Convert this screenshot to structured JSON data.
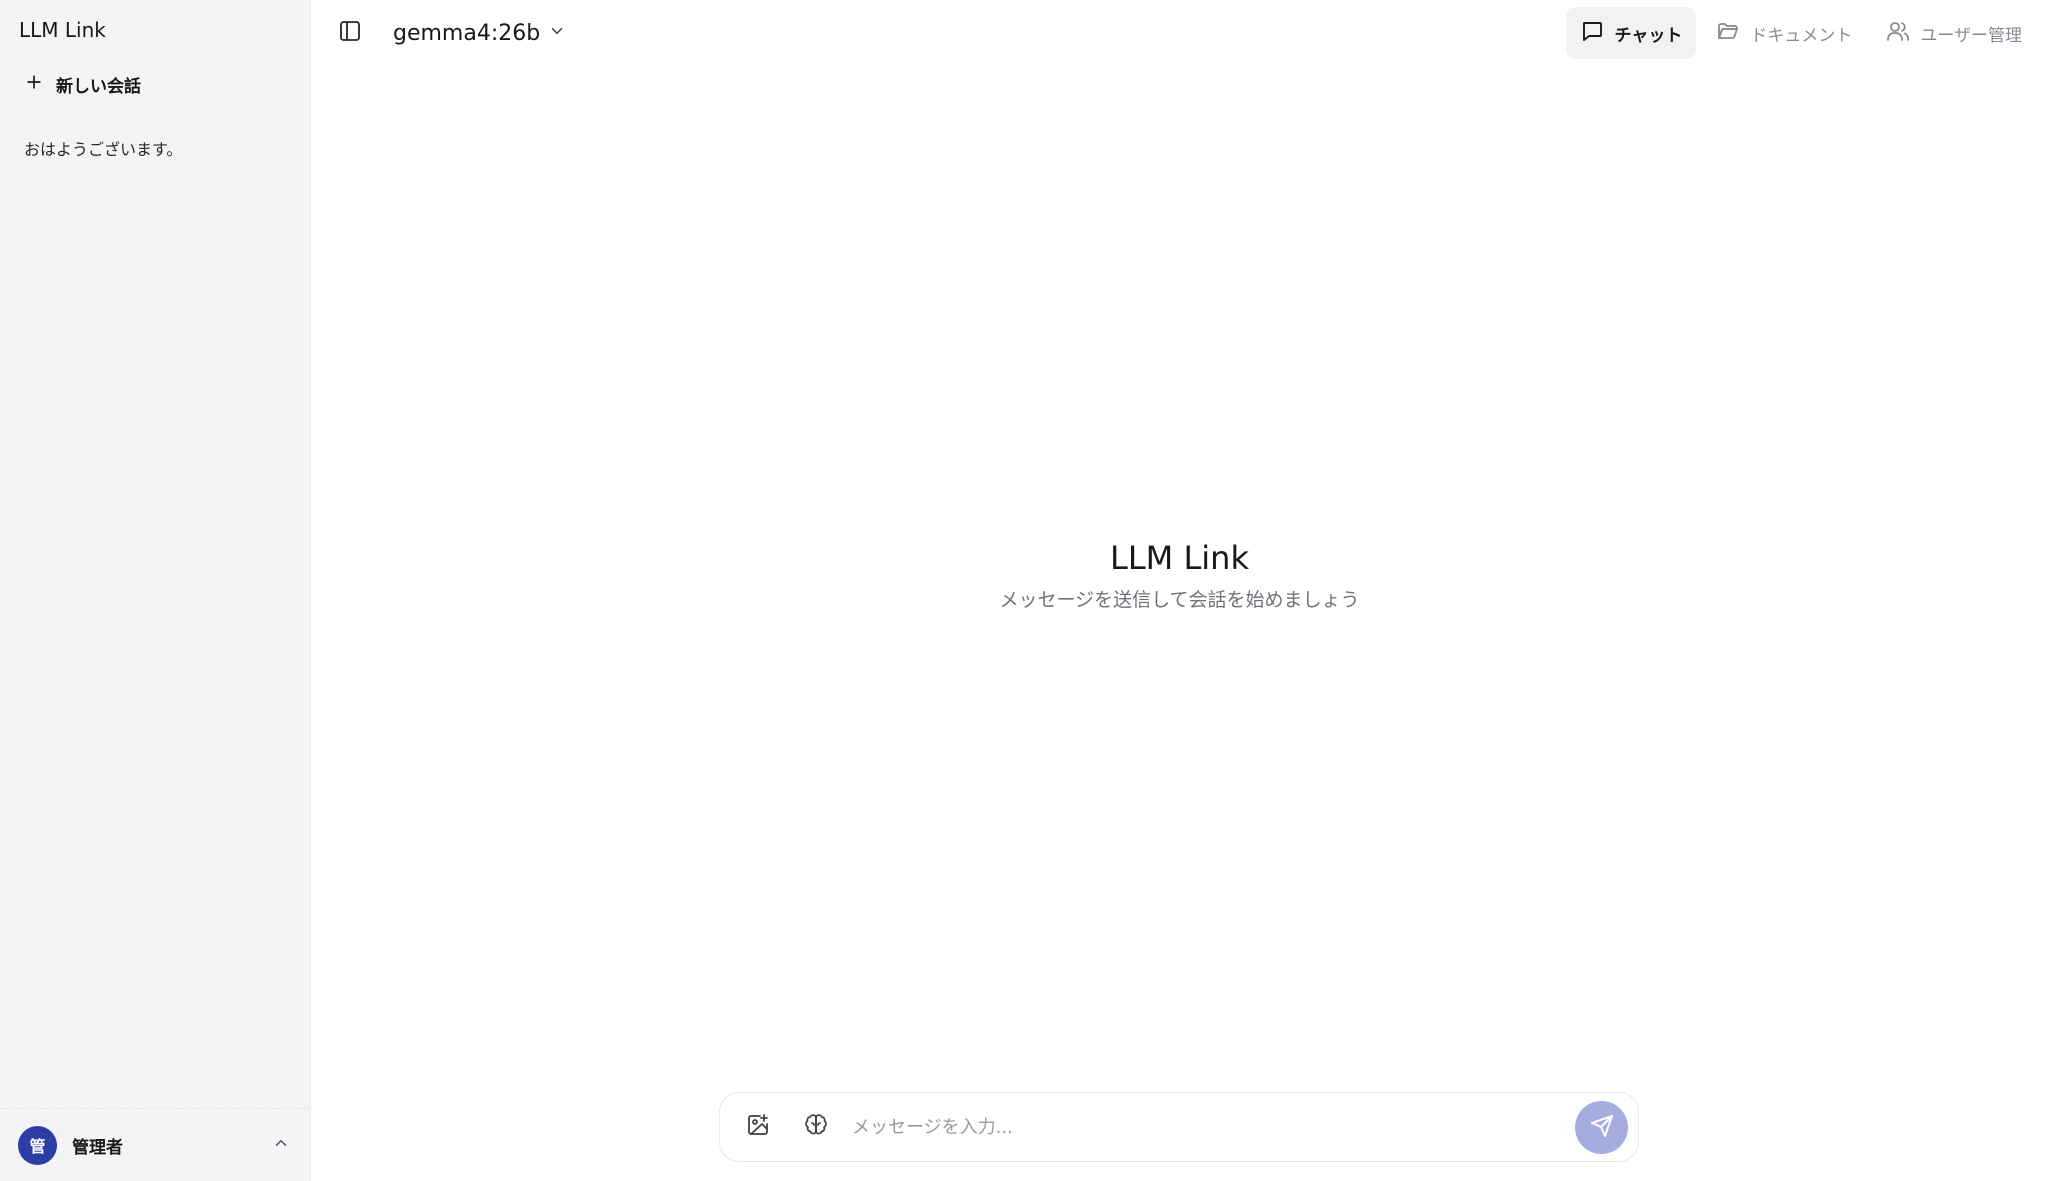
{
  "sidebar": {
    "title": "LLM Link",
    "new_chat_label": "新しい会話",
    "conversations": [
      {
        "title": "おはようございます。"
      }
    ],
    "user": {
      "avatar_initial": "管",
      "name": "管理者"
    }
  },
  "header": {
    "model": "gemma4:26b",
    "nav": [
      {
        "label": "チャット",
        "icon": "chat-icon",
        "active": true
      },
      {
        "label": "ドキュメント",
        "icon": "folder-icon",
        "active": false
      },
      {
        "label": "ユーザー管理",
        "icon": "users-icon",
        "active": false
      }
    ]
  },
  "empty_state": {
    "title": "LLM Link",
    "subtitle": "メッセージを送信して会話を始めましょう"
  },
  "composer": {
    "placeholder": "メッセージを入力...",
    "value": ""
  },
  "colors": {
    "accent": "#2c3da6",
    "send_button": "#a5acde",
    "sidebar_bg": "#f4f4f6"
  }
}
